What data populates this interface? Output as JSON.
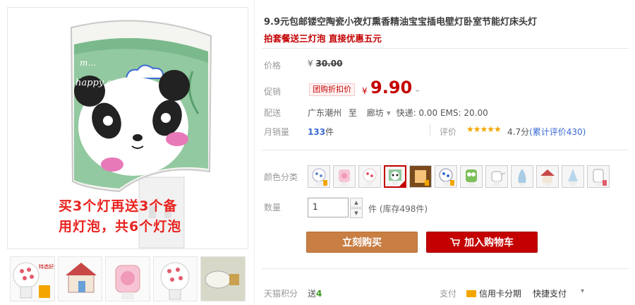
{
  "product": {
    "title": "9.9元包邮镂空陶瓷小夜灯熏香精油宝宝插电壁灯卧室节能灯床头灯",
    "subtitle": "拍套餐送三灯泡 直接优惠五元"
  },
  "main_image": {
    "lamp_text": "happy one day",
    "lamp_text_small": "m...",
    "promo_line1": "买3个灯再送3个备",
    "promo_line2": "用灯泡，共6个灯泡"
  },
  "thumbnails": [
    {
      "name": "thumb-polka-dot-lamp",
      "caption": "特选好灯"
    },
    {
      "name": "thumb-house-lamp"
    },
    {
      "name": "thumb-pink-pig-lamp"
    },
    {
      "name": "thumb-dot-ball-lamp"
    },
    {
      "name": "thumb-bulb"
    }
  ],
  "price": {
    "label": "价格",
    "currency": "¥",
    "original": "30.00"
  },
  "promo": {
    "label": "促销",
    "tag": "团购折扣价",
    "currency": "¥",
    "value": "9.90",
    "caret": "⌄"
  },
  "shipping": {
    "label": "配送",
    "origin": "广东潮州",
    "to_word": "至",
    "destination": "廊坊",
    "caret": "▾",
    "fees": "快递: 0.00 EMS: 20.00"
  },
  "sales": {
    "label": "月销量",
    "count": "133",
    "unit": "件"
  },
  "rating": {
    "label": "评价",
    "stars": "★★★★★",
    "score": "4.7分",
    "count_text": "(累计评价430)"
  },
  "color": {
    "label": "颜色分类",
    "options_count_text": "",
    "swatches": [
      {
        "name": "swatch-blue-dots"
      },
      {
        "name": "swatch-pink-pig"
      },
      {
        "name": "swatch-pink-dots"
      },
      {
        "name": "swatch-panda",
        "selected": true
      },
      {
        "name": "swatch-orange-glow"
      },
      {
        "name": "swatch-blue-pattern"
      },
      {
        "name": "swatch-green-owl"
      },
      {
        "name": "swatch-teapot"
      },
      {
        "name": "swatch-blue-vase"
      },
      {
        "name": "swatch-red-house"
      },
      {
        "name": "swatch-blue-tree"
      },
      {
        "name": "swatch-white-cylinder"
      }
    ]
  },
  "quantity": {
    "label": "数量",
    "value": "1",
    "up": "▲",
    "down": "▼",
    "stock_text": "件 (库存498件)"
  },
  "buttons": {
    "buy_now": "立刻购买",
    "add_cart": "加入购物车"
  },
  "footer": {
    "points_label": "天猫积分",
    "points_prefix": "送",
    "points_value": "4",
    "pay_label": "支付",
    "credit": "信用卡分期",
    "quick_pay": "快捷支付",
    "caret": "▾"
  },
  "colors": {
    "accent_red": "#c40000",
    "buy_orange": "#c97e43",
    "star_gold": "#f3a600",
    "link_blue": "#3a6ad2"
  }
}
